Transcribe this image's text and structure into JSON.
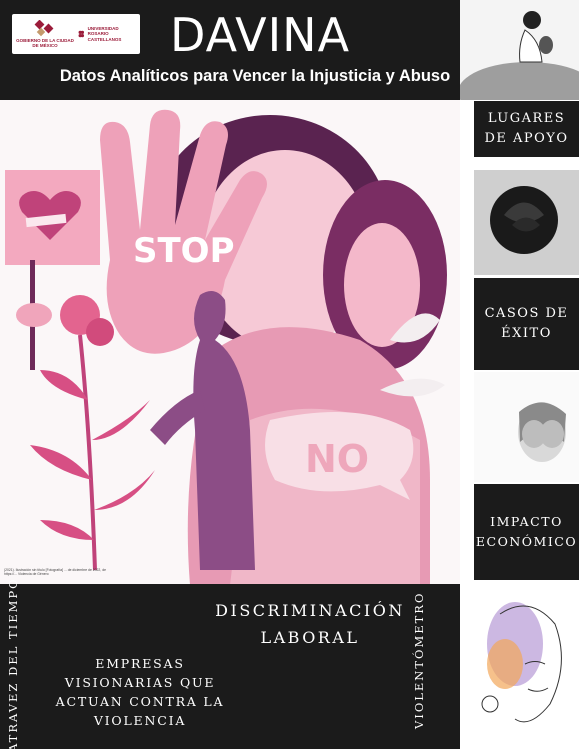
{
  "header": {
    "title": "DAVINA",
    "subtitle": "Datos Analíticos para Vencer la Injusticia y Abuso",
    "logo_left_text": "GOBIERNO DE LA CIUDAD DE MÉXICO",
    "logo_right_text": "UNIVERSIDAD ROSARIO CASTELLANOS"
  },
  "hero": {
    "sign_stop": "STOP",
    "sign_no": "NO",
    "caption": "(2021). Ilustración sin título [Fotografía] ... de diciembre de 2022, de https://... Violencia de Género"
  },
  "menu": {
    "lugares": "LUGARES DE APOYO",
    "casos": "CASOS DE ÉXITO",
    "impacto": "IMPACTO ECONÓMICO"
  },
  "bottom": {
    "atravez": "ATRAVEZ DEL TIEMPO",
    "discriminacion": "DISCRIMINACIÓN LABORAL",
    "empresas": "EMPRESAS VISIONARIAS QUE ACTUAN CONTRA LA VIOLENCIA",
    "violentometro": "VIOLENTÓMETRO"
  },
  "colors": {
    "dark": "#1b1b1b",
    "pink_light": "#f2b5c6",
    "pink": "#e57fa1",
    "magenta": "#c0437a",
    "purple": "#6e2a5a",
    "brand_red": "#9b1c3a"
  },
  "icons": [
    "logo-cdmx-icon",
    "logo-urc-icon",
    "broken-heart-icon"
  ]
}
